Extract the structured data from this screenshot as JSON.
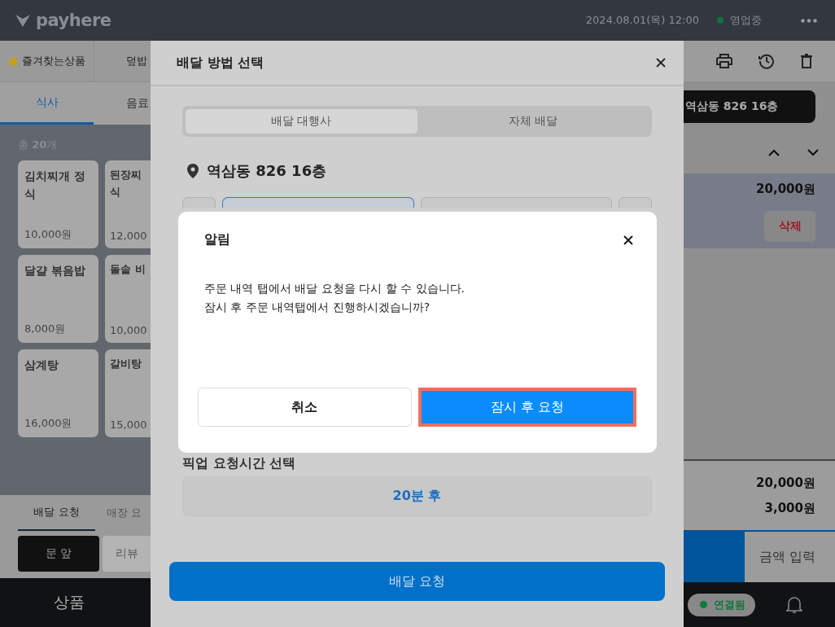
{
  "topbar": {
    "logo": "payhere",
    "datetime": "2024.08.01(목) 12:00",
    "status": "영업중"
  },
  "category_row": [
    {
      "label": "즐겨찾는상품",
      "kind": "favorite"
    },
    {
      "label": "덮밥",
      "kind": "plain"
    }
  ],
  "category_tabs": [
    {
      "label": "식사",
      "selected": true
    },
    {
      "label": "음료",
      "selected": false
    }
  ],
  "count": "총 **20**개",
  "products": [
    {
      "name": "김치찌개 정식",
      "price": "10,000원"
    },
    {
      "name": "된장찌\n식",
      "price": "12,000"
    },
    {
      "name": "달걀 볶음밥",
      "price": "8,000원"
    },
    {
      "name": "돌솥 비",
      "price": "10,000"
    },
    {
      "name": "삼계탕",
      "price": "16,000원"
    },
    {
      "name": "갈비탕",
      "price": "15,000"
    }
  ],
  "order_tabs": [
    {
      "label": "배달 요청",
      "selected": true
    },
    {
      "label": "매장 요",
      "selected": false
    }
  ],
  "request_chips": [
    {
      "label": "문 앞",
      "selected": true
    },
    {
      "label": "리뷰",
      "selected": false
    }
  ],
  "bottom_nav": {
    "label": "상품"
  },
  "order_panel": {
    "address": "역삼동 826 16층",
    "items": [
      {
        "price": "20,000원",
        "delete_label": "삭제",
        "selected": true
      }
    ],
    "subtotal": "20,000원",
    "delivery_fee": "3,000원",
    "amount_button": "금액 입력",
    "connection": "연결됨"
  },
  "sheet": {
    "title": "배달 방법 선택",
    "tabs": [
      {
        "label": "배달 대행사",
        "selected": true
      },
      {
        "label": "자체 배달",
        "selected": false
      }
    ],
    "address": "역삼동 826 16층",
    "pickup_label": "픽업 요청시간 선택",
    "pickup_time": "20분 후",
    "submit": "배달 요청"
  },
  "dialog": {
    "title": "알림",
    "message": [
      "주문 내역 탭에서 배달 요청을 다시 할 수 있습니다.",
      "잠시 후 주문 내역탭에서 진행하시겠습니까?"
    ],
    "buttons": [
      {
        "label": "취소",
        "kind": "secondary",
        "highlighted": false
      },
      {
        "label": "잠시 후 요청",
        "kind": "primary",
        "highlighted": true
      }
    ]
  }
}
